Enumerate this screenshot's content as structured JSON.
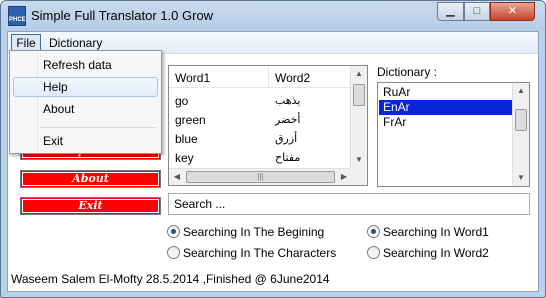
{
  "window": {
    "title": "Simple Full Translator 1.0 Grow",
    "app_icon_text": "PHCE",
    "minimize_glyph": "▁",
    "maximize_glyph": "□",
    "close_glyph": "✕"
  },
  "menubar": {
    "file": "File",
    "dictionary": "Dictionary"
  },
  "file_menu": {
    "items": [
      "Refresh data",
      "Help",
      "About",
      "Exit"
    ]
  },
  "buttons": {
    "update": "Update",
    "about": "About",
    "exit": "Exit"
  },
  "word_list": {
    "columns": [
      "Word1",
      "Word2"
    ],
    "rows": [
      {
        "word1": "go",
        "word2": "يذهب"
      },
      {
        "word1": "green",
        "word2": "أخضر"
      },
      {
        "word1": "blue",
        "word2": "أزرق"
      },
      {
        "word1": "key",
        "word2": "مفتاح"
      }
    ]
  },
  "dictionary": {
    "label": "Dictionary :",
    "items": [
      "RuAr",
      "EnAr",
      "FrAr"
    ],
    "selected": "EnAr"
  },
  "search": {
    "value": "Search ..."
  },
  "options": {
    "begin": "Searching In The Begining",
    "characters": "Searching In The Characters",
    "word1": "Searching In Word1",
    "word2": "Searching In Word2",
    "selected_mode": "begin",
    "selected_field": "word1"
  },
  "footer": "Waseem Salem El-Mofty 28.5.2014 ,Finished @ 6June2014"
}
